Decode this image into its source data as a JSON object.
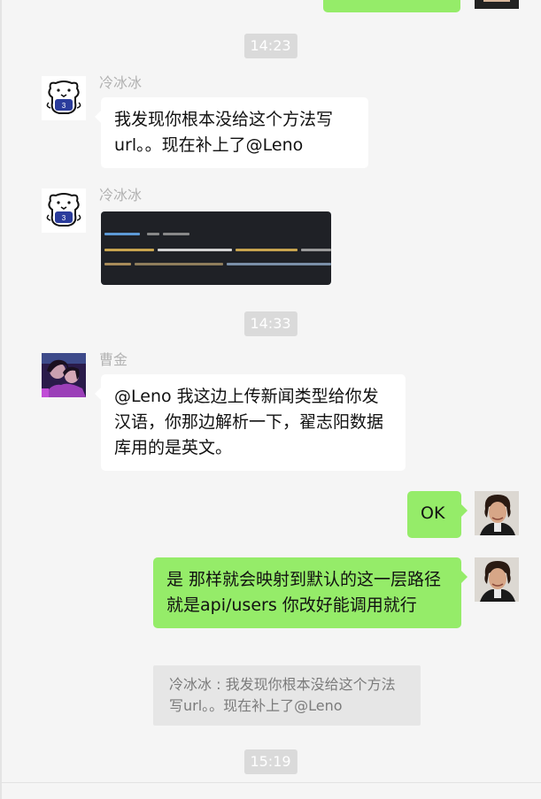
{
  "timestamps": [
    "14:23",
    "14:33",
    "15:19"
  ],
  "messages": [
    {
      "sender": "冷冰冰",
      "text": "我发现你根本没给这个方法写url。。现在补上了@Leno"
    },
    {
      "sender": "冷冰冰",
      "image": "code-screenshot"
    },
    {
      "sender": "曹金",
      "text": "@Leno 我这边上传新闻类型给你发汉语，你那边解析一下，翟志阳数据库用的是英文。"
    },
    {
      "text": "OK"
    },
    {
      "text": "是 那样就会映射到默认的这一层路径 就是api/users 你改好能调用就行"
    },
    {
      "quote": "冷冰冰 : 我发现你根本没给这个方法写url。。现在补上了@Leno"
    }
  ],
  "colors": {
    "background": "#f5f5f5",
    "own_bubble": "#95ec69",
    "other_bubble": "#ffffff",
    "timestamp_bg": "#dadada",
    "sender_name": "#b2b2b2"
  },
  "icons": [
    "avatar-bear",
    "avatar-caojin",
    "avatar-self"
  ]
}
